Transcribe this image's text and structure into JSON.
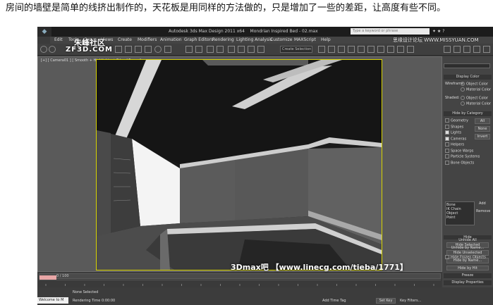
{
  "caption": "房间的墙壁是简单的线挤出制作的，天花板是用同样的方法做的，只是增加了一些的差距，让高度有些不同。",
  "title": {
    "app": "Autodesk 3ds Max Design 2011 x64",
    "file": "Mondrian Inspired Bed - 02.max",
    "search_placeholder": "Type a keyword or phrase"
  },
  "menu": [
    "Edit",
    "Tools",
    "Group",
    "Views",
    "Create",
    "Modifiers",
    "Animation",
    "Graph Editors",
    "Rendering",
    "Lighting Analysis",
    "Customize",
    "MAXScript",
    "Help"
  ],
  "toolbar": {
    "dropdown": "Create Selection"
  },
  "watermarks": {
    "top_left": "朱峰社区",
    "top_left_2": "ZF3D.COM",
    "top_right": "思缘设计论坛 WWW.MISSYUAN.COM",
    "bottom": "3Dmax吧 【www.linecg.com/tieba/1771】"
  },
  "viewport": {
    "label": "[+] [ Camera01 ] [ Smooth + Highlights + Edged Faces ]"
  },
  "command_panel": {
    "display_color": {
      "title": "Display Color",
      "wireframe_label": "Wireframe:",
      "shaded_label": "Shaded:",
      "object_color": "Object Color",
      "material_color": "Material Color"
    },
    "hide_by_category": {
      "title": "Hide by Category",
      "items": [
        {
          "label": "Geometry",
          "checked": false
        },
        {
          "label": "Shapes",
          "checked": false
        },
        {
          "label": "Lights",
          "checked": true
        },
        {
          "label": "Cameras",
          "checked": true
        },
        {
          "label": "Helpers",
          "checked": false
        },
        {
          "label": "Space Warps",
          "checked": false
        },
        {
          "label": "Particle Systems",
          "checked": false
        },
        {
          "label": "Bone Objects",
          "checked": false
        }
      ],
      "buttons": {
        "all": "All",
        "none": "None",
        "invert": "Invert"
      },
      "list": [
        "Bone",
        "IK Chain Object",
        "Point"
      ],
      "add": "Add",
      "remove": "Remove"
    },
    "hide": {
      "title": "Hide",
      "buttons": [
        "Hide Selected",
        "Hide Unselected",
        "Hide by Name...",
        "Hide by Hit",
        "Unhide All",
        "Unhide by Name..."
      ],
      "hide_frozen": "Hide Frozen Objects"
    },
    "freeze": "Freeze",
    "display_properties": "Display Properties"
  },
  "timeline": {
    "frame": "0 / 100",
    "ticks": [
      "0",
      "5",
      "10",
      "15",
      "20",
      "25",
      "30",
      "35",
      "40",
      "45",
      "50",
      "55",
      "60",
      "65",
      "70",
      "75",
      "80",
      "85",
      "90",
      "95",
      "100"
    ]
  },
  "status": {
    "welcome": "Welcome to M",
    "selection": "None Selected",
    "render_time": "Rendering Time  0:00:00",
    "add_time_tag": "Add Time Tag",
    "set_key": "Set Key",
    "key_filters": "Key Filters..."
  },
  "colors": {
    "viewport_border": "#d8d400",
    "app_bg": "#3b3b3b"
  }
}
